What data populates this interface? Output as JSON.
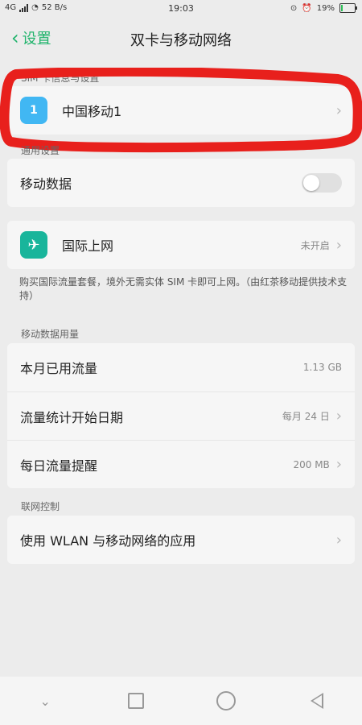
{
  "status_bar": {
    "network": "4G",
    "speed": "52 B/s",
    "time": "19:03",
    "battery_percent": "19%"
  },
  "header": {
    "back_label": "设置",
    "title": "双卡与移动网络"
  },
  "sections": {
    "sim": {
      "label": "SIM 卡信息与设置",
      "item_label": "中国移动1",
      "sim_icon_text": "1"
    },
    "general": {
      "label": "通用设置",
      "mobile_data_label": "移动数据",
      "mobile_data_enabled": false
    },
    "international": {
      "label": "国际上网",
      "status": "未开启",
      "description": "购买国际流量套餐，境外无需实体 SIM 卡即可上网。（由红茶移动提供技术支持）"
    },
    "usage": {
      "label": "移动数据用量",
      "rows": [
        {
          "label": "本月已用流量",
          "value": "1.13 GB",
          "chevron": false
        },
        {
          "label": "流量统计开始日期",
          "value": "每月 24 日",
          "chevron": true
        },
        {
          "label": "每日流量提醒",
          "value": "200 MB",
          "chevron": true
        }
      ]
    },
    "network_control": {
      "label": "联网控制",
      "item_label": "使用 WLAN 与移动网络的应用"
    }
  },
  "colors": {
    "accent": "#1fb36b",
    "sim_icon": "#41b7f3",
    "globe_icon": "#19b59b",
    "annotation": "#e8201c"
  },
  "icons": {
    "back": "chevron-left-icon",
    "sim": "sim-card-icon",
    "globe": "globe-icon",
    "chevron": "chevron-right-icon",
    "nav": [
      "chevron-down-icon",
      "square-icon",
      "circle-icon",
      "triangle-back-icon"
    ]
  }
}
